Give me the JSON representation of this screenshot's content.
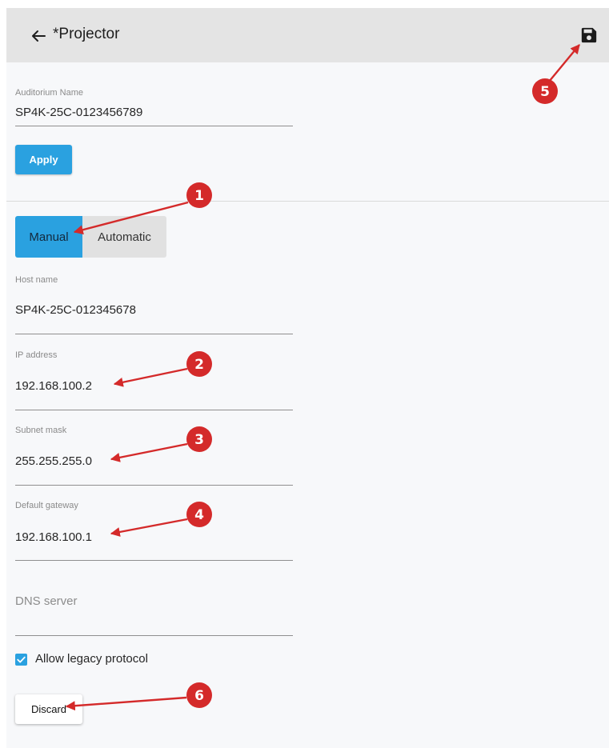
{
  "header": {
    "title": "*Projector",
    "back_icon": "arrow-left-icon",
    "save_icon": "floppy-disk-icon"
  },
  "auditorium": {
    "label": "Auditorium Name",
    "value": "SP4K-25C-0123456789",
    "apply_label": "Apply"
  },
  "network": {
    "modes": [
      "Manual",
      "Automatic"
    ],
    "selected_mode": "Manual",
    "host_name": {
      "label": "Host name",
      "value": "SP4K-25C-012345678"
    },
    "ip_address": {
      "label": "IP address",
      "value": "192.168.100.2"
    },
    "subnet_mask": {
      "label": "Subnet mask",
      "value": "255.255.255.0"
    },
    "default_gateway": {
      "label": "Default gateway",
      "value": "192.168.100.1"
    },
    "dns_server": {
      "label": "DNS server",
      "value": ""
    }
  },
  "legacy": {
    "label": "Allow legacy protocol",
    "checked": true
  },
  "discard_label": "Discard",
  "callouts": [
    "1",
    "2",
    "3",
    "4",
    "5",
    "6"
  ],
  "colors": {
    "accent": "#2aa1e0",
    "callout": "#d42a2a",
    "header_bg": "#e4e4e4",
    "page_bg": "#f7f8fa"
  }
}
